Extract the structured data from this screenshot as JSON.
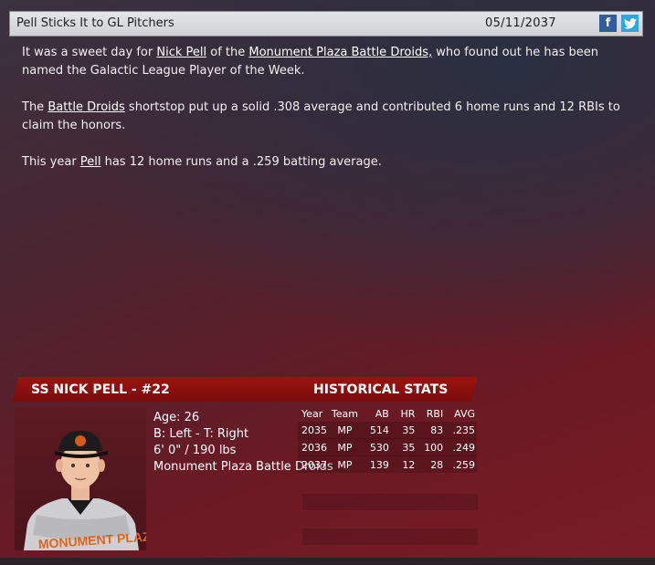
{
  "header": {
    "title": "Pell Sticks It to GL Pitchers",
    "date": "05/11/2037",
    "facebook_icon_glyph": "f",
    "twitter_icon": "twitter-bird"
  },
  "article": {
    "p1_a": "It was a sweet day for ",
    "p1_link1": "Nick Pell",
    "p1_b": " of the ",
    "p1_link2": "Monument Plaza Battle Droids,",
    "p1_c": " who found out he has been named the Galactic League Player of the Week.",
    "p2_a": "The ",
    "p2_link1": "Battle Droids",
    "p2_b": " shortstop put up a solid .308 average and contributed 6 home runs and 12 RBIs to claim the honors.",
    "p3_a": "This year ",
    "p3_link1": "Pell",
    "p3_b": " has 12 home runs and a .259 batting average."
  },
  "player": {
    "header": "SS NICK PELL - #22",
    "age": "Age: 26",
    "bats_throws": "B: Left - T: Right",
    "height_weight": "6' 0\" / 190 lbs",
    "team": "Monument Plaza Battle Droids"
  },
  "stats": {
    "header": "HISTORICAL STATS",
    "columns": [
      "Year",
      "Team",
      "AB",
      "HR",
      "RBI",
      "AVG"
    ],
    "rows": [
      [
        "2035",
        "MP",
        "514",
        "35",
        "83",
        ".235"
      ],
      [
        "2036",
        "MP",
        "530",
        "35",
        "100",
        ".249"
      ],
      [
        "2037",
        "MP",
        "139",
        "12",
        "28",
        ".259"
      ]
    ]
  },
  "colors": {
    "facebook": "#2f5d9e",
    "twitter": "#2fa6e0",
    "header_red": "#8e1210"
  }
}
